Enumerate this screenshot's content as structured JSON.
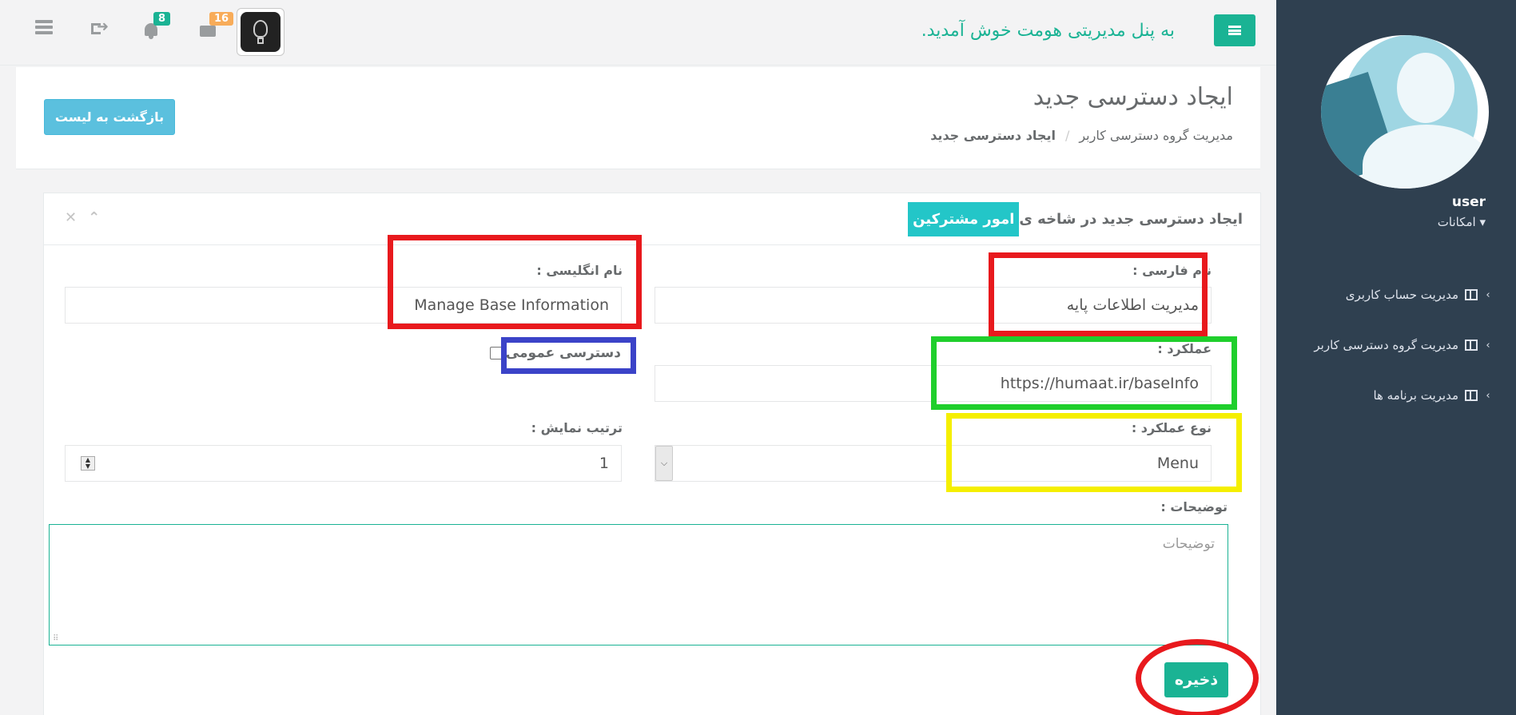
{
  "topbar": {
    "welcome": "به پنل مدیریتی هومت خوش آمدید.",
    "notifications_count": "8",
    "messages_count": "16"
  },
  "sidebar": {
    "user_name": "user",
    "menu_toggle": "امکانات ▾",
    "items": [
      {
        "label": "مدیریت حساب کاربری"
      },
      {
        "label": "مدیریت گروه دسترسی کاربر"
      },
      {
        "label": "مدیریت برنامه ها"
      }
    ]
  },
  "heading": {
    "title": "ایجاد دسترسی جدید",
    "breadcrumb": [
      "مدیریت گروه دسترسی کاربر",
      "/",
      "ایجاد دسترسی جدید"
    ],
    "back_button": "بازگشت به لیست"
  },
  "panel": {
    "title_prefix": "ایجاد دسترسی جدید در شاخه ی",
    "branch": "امور مشترکین",
    "tools": {
      "collapse": "⌃",
      "close": "✕"
    }
  },
  "form": {
    "persian_name_label": "نام فارسی :",
    "persian_name_value": "مدیریت اطلاعات پایه",
    "english_name_label": "نام انگلیسی :",
    "english_name_value": "Manage Base Information",
    "action_label": "عملکرد :",
    "action_value": "https://humaat.ir/baseInfo",
    "public_access_label": "دسترسی عمومی",
    "public_access_checked": false,
    "action_type_label": "نوع عملکرد :",
    "action_type_value": "Menu",
    "display_order_label": "ترتیب نمایش :",
    "display_order_value": "1",
    "description_label": "توضیحات :",
    "description_placeholder": "توضیحات",
    "save_button": "ذخیره"
  },
  "colors": {
    "primary": "#1ab394",
    "info": "#5bc0de",
    "sidebar": "#2f4050",
    "highlight_red": "#e8191d",
    "highlight_green": "#1fcf2c",
    "highlight_yellow": "#f5ef00",
    "highlight_blue": "#3b43c8"
  }
}
